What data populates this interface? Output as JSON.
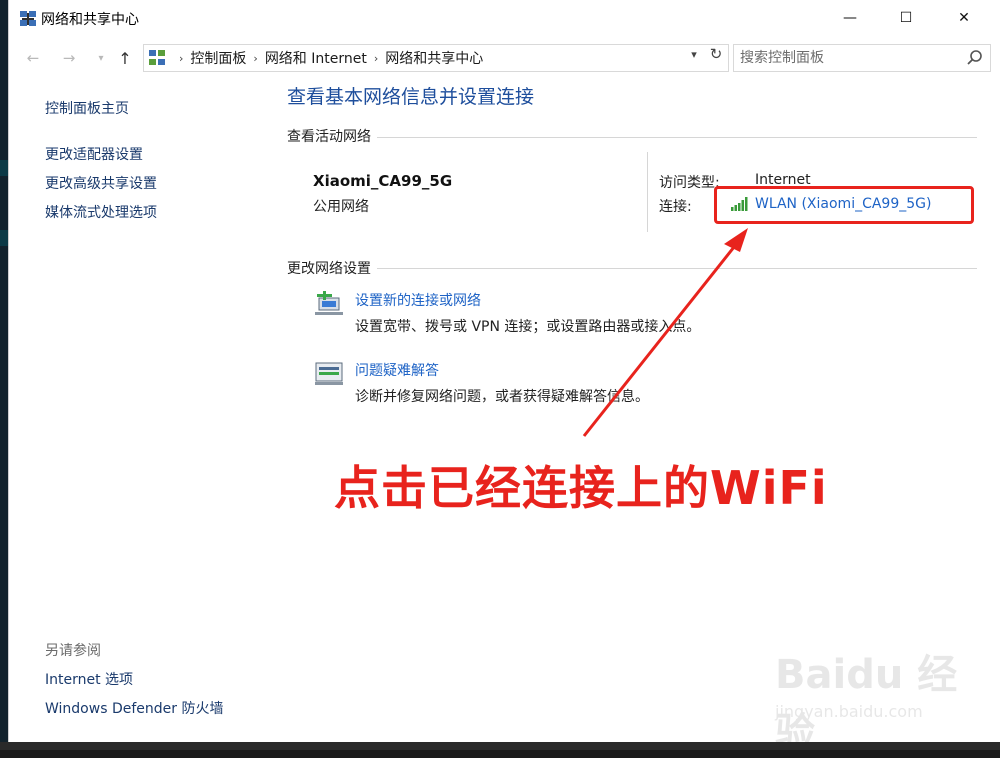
{
  "window": {
    "title": "网络和共享中心"
  },
  "titlebar": {
    "min_glyph": "—",
    "max_glyph": "☐",
    "close_glyph": "✕"
  },
  "address": {
    "crumbs": [
      "控制面板",
      "网络和 Internet",
      "网络和共享中心"
    ],
    "search_placeholder": "搜索控制面板"
  },
  "sidebar": {
    "home": "控制面板主页",
    "items": [
      "更改适配器设置",
      "更改高级共享设置",
      "媒体流式处理选项"
    ],
    "see_also_label": "另请参阅",
    "see_also": [
      "Internet 选项",
      "Windows Defender 防火墙"
    ]
  },
  "main": {
    "title": "查看基本网络信息并设置连接",
    "active_section": "查看活动网络",
    "network_name": "Xiaomi_CA99_5G",
    "network_type": "公用网络",
    "access_type_label": "访问类型:",
    "access_type_value": "Internet",
    "connection_label": "连接:",
    "connection_value": "WLAN (Xiaomi_CA99_5G)",
    "change_section": "更改网络设置",
    "tasks": [
      {
        "title": "设置新的连接或网络",
        "desc": "设置宽带、拨号或 VPN 连接；或设置路由器或接入点。",
        "icon": "network-setup-icon"
      },
      {
        "title": "问题疑难解答",
        "desc": "诊断并修复网络问题，或者获得疑难解答信息。",
        "icon": "troubleshoot-icon"
      }
    ]
  },
  "annotation": {
    "text": "点击已经连接上的WiFi",
    "color": "#e8231d"
  },
  "watermark": {
    "logo": "Baidu 经验",
    "url": "jingyan.baidu.com"
  },
  "colors": {
    "link": "#1e63c6",
    "title": "#1e4e9c",
    "nav_link": "#1a3a6c"
  }
}
